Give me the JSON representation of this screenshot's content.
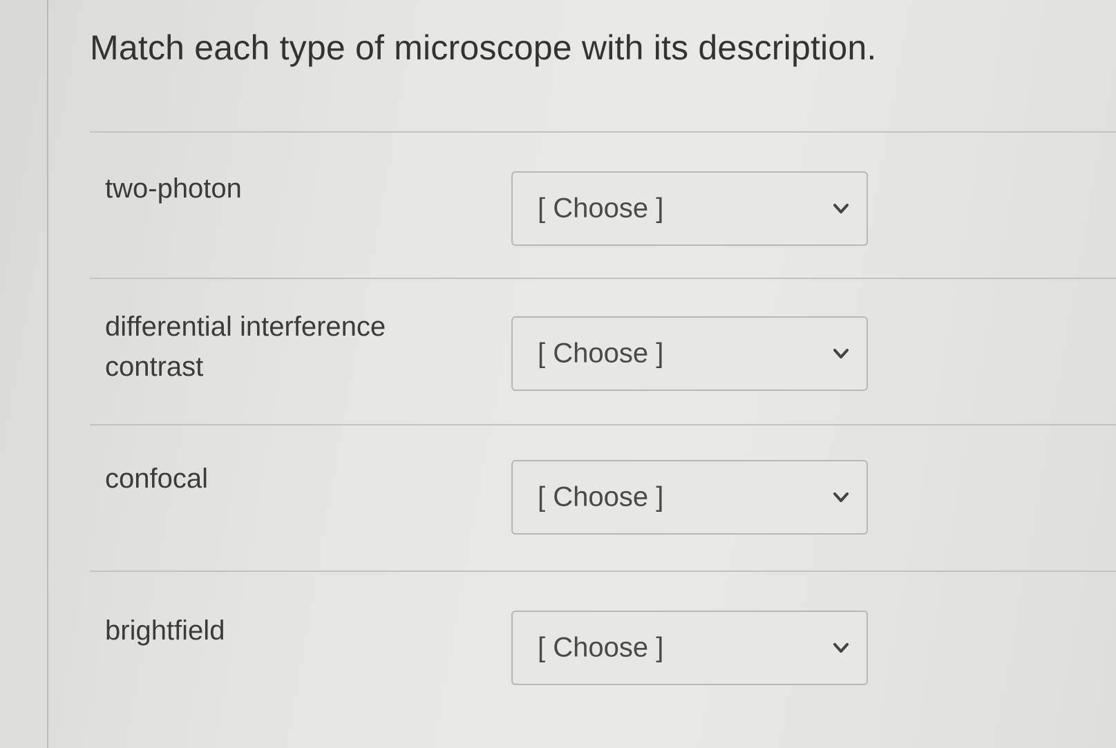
{
  "question": {
    "title": "Match each type of microscope with its description."
  },
  "rows": [
    {
      "term": "two-photon",
      "selected": "[ Choose ]"
    },
    {
      "term": "differential interference contrast",
      "selected": "[ Choose ]"
    },
    {
      "term": "confocal",
      "selected": "[ Choose ]"
    },
    {
      "term": "brightfield",
      "selected": "[ Choose ]"
    }
  ],
  "icons": {
    "dropdown": "chevron-down-icon"
  },
  "colors": {
    "background": "#e4e4e1",
    "text": "#333333",
    "border": "#b8b8b5"
  }
}
